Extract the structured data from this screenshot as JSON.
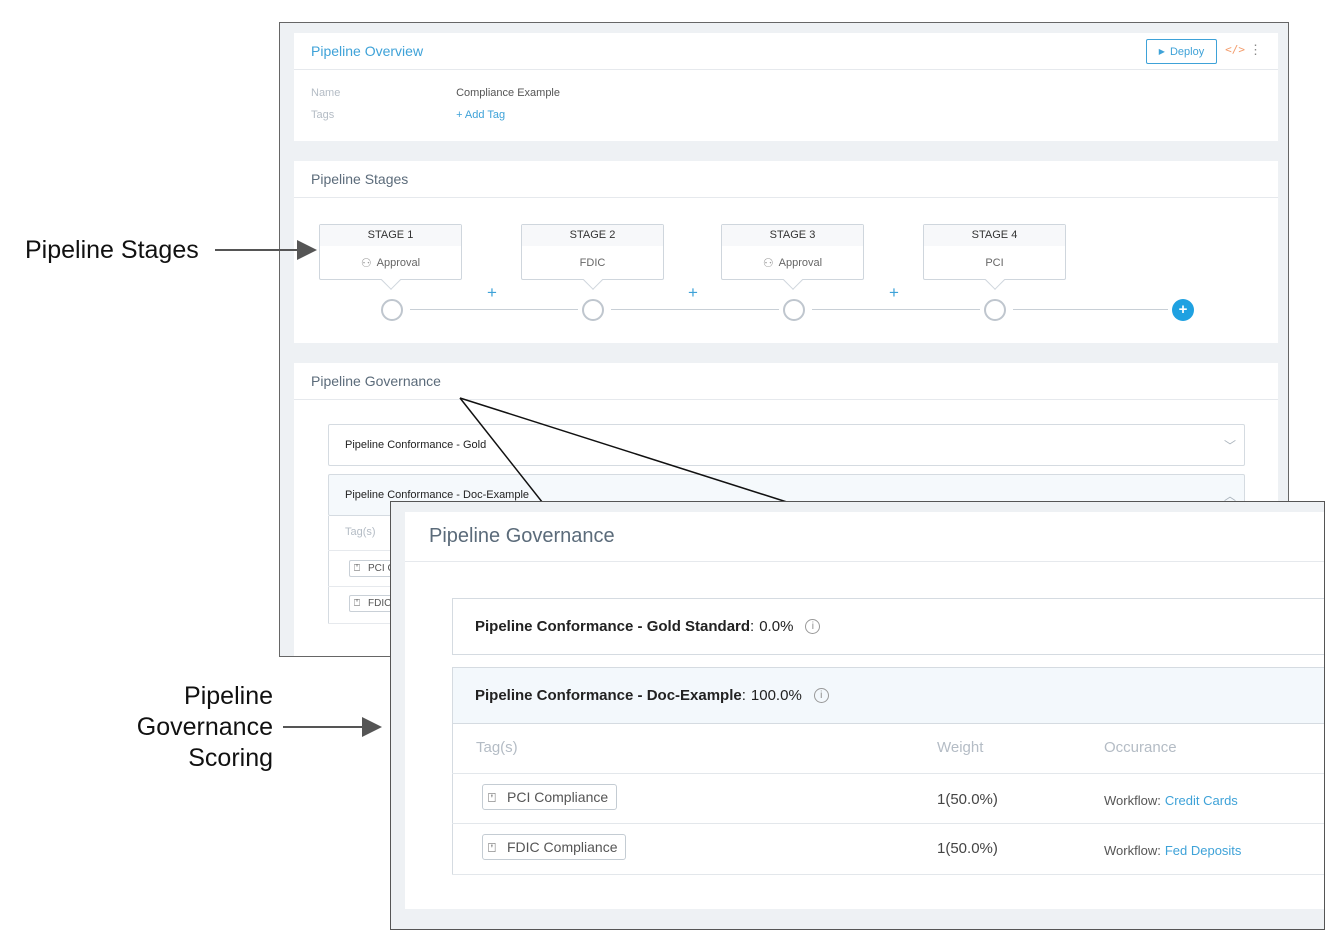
{
  "overview": {
    "title": "Pipeline Overview",
    "deploy_label": "Deploy",
    "name_key": "Name",
    "name_value": "Compliance Example",
    "tags_key": "Tags",
    "add_tag": "+ Add Tag"
  },
  "stages": {
    "title": "Pipeline Stages",
    "items": [
      {
        "label": "STAGE 1",
        "body": "Approval",
        "icon": "approval-icon"
      },
      {
        "label": "STAGE 2",
        "body": "FDIC",
        "icon": ""
      },
      {
        "label": "STAGE 3",
        "body": "Approval",
        "icon": "approval-icon"
      },
      {
        "label": "STAGE 4",
        "body": "PCI",
        "icon": ""
      }
    ],
    "plus": "+"
  },
  "governance": {
    "title": "Pipeline Governance",
    "rows": [
      {
        "name": "Pipeline Conformance - Gold",
        "name_full": "Pipeline Conformance - Gold Standard",
        "score": "0.0%"
      },
      {
        "name": "Pipeline Conformance - Doc-Example",
        "name_full": "Pipeline Conformance - Doc-Example",
        "score": "100.0%"
      }
    ],
    "small_tag_header": "Tag(s)",
    "small_tags": [
      "PCI C",
      "FDIC"
    ],
    "table": {
      "headers": [
        "Tag(s)",
        "Weight",
        "Occurance"
      ],
      "rows": [
        {
          "tag": "PCI Compliance",
          "weight": "1(50.0%)",
          "workflow_label": "Workflow:",
          "workflow": "Credit Cards"
        },
        {
          "tag": "FDIC Compliance",
          "weight": "1(50.0%)",
          "workflow_label": "Workflow:",
          "workflow": "Fed Deposits"
        }
      ]
    }
  },
  "callouts": {
    "stages": "Pipeline Stages",
    "scoring_line1": "Pipeline",
    "scoring_line2": "Governance",
    "scoring_line3": "Scoring"
  },
  "colors": {
    "accent": "#3ea2d8",
    "add_button": "#1fa1e1",
    "code_icon": "#f39c6b"
  }
}
